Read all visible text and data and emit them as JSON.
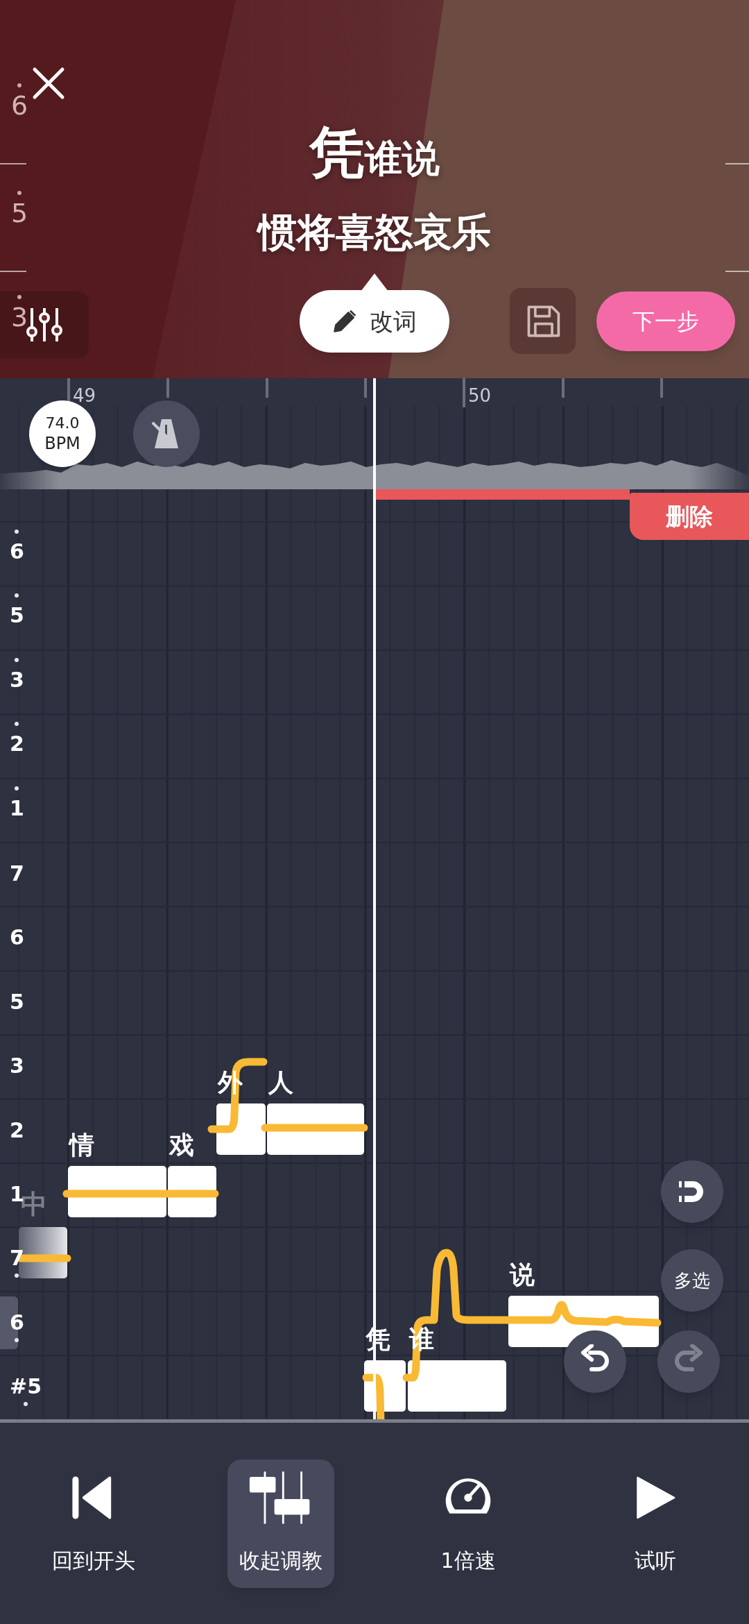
{
  "header": {
    "pitch_labels": [
      {
        "text": "6",
        "dot_above": true
      },
      {
        "text": "5",
        "dot_above": true
      },
      {
        "text": "3",
        "dot_above": true
      }
    ],
    "lyric_line_1": {
      "current": "凭",
      "rest": "谁说"
    },
    "lyric_line_2": "惯将喜怒哀乐",
    "edit_lyrics_button": "改词",
    "next_button": "下一步"
  },
  "ruler": {
    "bars": [
      "49",
      "50"
    ]
  },
  "bpm": {
    "value": "74.0",
    "unit": "BPM"
  },
  "delete_button": "删除",
  "pitch_labels": [
    {
      "text": "6",
      "dot_above": true
    },
    {
      "text": "5",
      "dot_above": true
    },
    {
      "text": "3",
      "dot_above": true
    },
    {
      "text": "2",
      "dot_above": true
    },
    {
      "text": "1",
      "dot_above": true
    },
    {
      "text": "7"
    },
    {
      "text": "6"
    },
    {
      "text": "5"
    },
    {
      "text": "3"
    },
    {
      "text": "2"
    },
    {
      "text": "1"
    },
    {
      "text": "7",
      "dot_below": true
    },
    {
      "text": "6",
      "dot_below": true
    },
    {
      "text": "#5",
      "dot_below": true
    }
  ],
  "range_label": "中",
  "notes": [
    {
      "kind": "faded"
    },
    {
      "lyric": "情",
      "kind": "normal"
    },
    {
      "lyric": "戏",
      "kind": "normal"
    },
    {
      "lyric": "外",
      "kind": "normal"
    },
    {
      "lyric": "人",
      "kind": "normal"
    },
    {
      "lyric": "凭",
      "kind": "normal"
    },
    {
      "lyric": "谁",
      "kind": "normal"
    },
    {
      "lyric": "说",
      "kind": "normal"
    }
  ],
  "side_buttons": {
    "multi_select": "多选",
    "redo_disabled": true
  },
  "toolbar": [
    {
      "label": "回到开头",
      "kind": "rewind",
      "selected": false
    },
    {
      "label": "收起调教",
      "kind": "tune",
      "selected": true
    },
    {
      "label": "1倍速",
      "kind": "speed",
      "selected": false
    },
    {
      "label": "试听",
      "kind": "play",
      "selected": false
    }
  ]
}
